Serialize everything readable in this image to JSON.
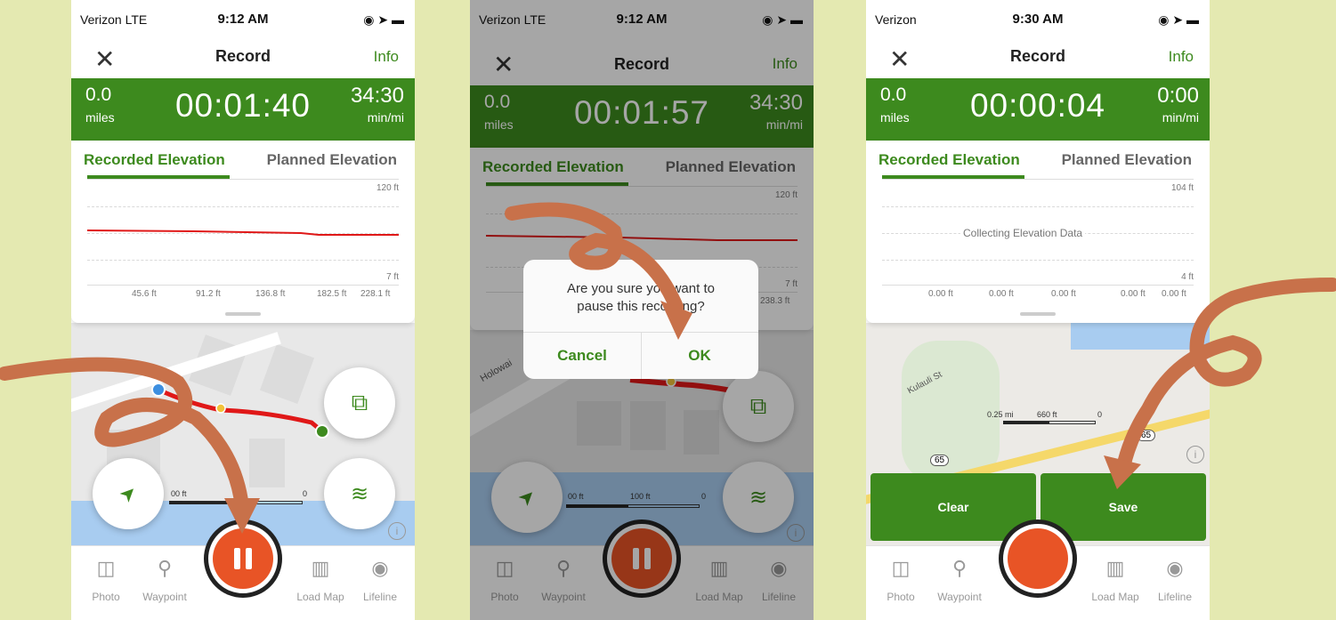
{
  "colors": {
    "brand_green": "#3d8a1e",
    "record_orange": "#e85426",
    "background": "#e4e9b1",
    "arrow": "#c8714a"
  },
  "screens": [
    {
      "status": {
        "carrier": "Verizon  LTE",
        "time": "9:12 AM"
      },
      "nav": {
        "close": "✕",
        "title": "Record",
        "info": "Info"
      },
      "stats": {
        "distance": "0.0",
        "distance_unit": "miles",
        "timer": "00:01:40",
        "pace": "34:30",
        "pace_unit": "min/mi"
      },
      "tabs": {
        "recorded": "Recorded Elevation",
        "planned": "Planned Elevation"
      },
      "axis": {
        "ymax": "120 ft",
        "ymin": "7 ft",
        "x": [
          "45.6 ft",
          "91.2 ft",
          "136.8 ft",
          "182.5 ft",
          "228.1 ft"
        ]
      },
      "scale": {
        "left": "00 ft",
        "mid": "ft",
        "right": "0"
      },
      "tabbar": {
        "photo": "Photo",
        "waypoint": "Waypoint",
        "loadmap": "Load Map",
        "lifeline": "Lifeline"
      }
    },
    {
      "status": {
        "carrier": "Verizon  LTE",
        "time": "9:12 AM"
      },
      "nav": {
        "close": "✕",
        "title": "Record",
        "info": "Info"
      },
      "stats": {
        "distance": "0.0",
        "distance_unit": "miles",
        "timer": "00:01:57",
        "pace": "34:30",
        "pace_unit": "min/mi"
      },
      "tabs": {
        "recorded": "Recorded Elevation",
        "planned": "Planned Elevation"
      },
      "axis": {
        "ymax": "120 ft",
        "ymin": "7 ft",
        "x_last": "238.3 ft"
      },
      "map_label": "Holowai",
      "scale": {
        "left": "00 ft",
        "mid": "100 ft",
        "right": "0"
      },
      "dialog": {
        "message_line1": "Are you sure you want to",
        "message_line2": "pause this recording?",
        "cancel": "Cancel",
        "ok": "OK"
      },
      "tabbar": {
        "photo": "Photo",
        "waypoint": "Waypoint",
        "loadmap": "Load Map",
        "lifeline": "Lifeline"
      }
    },
    {
      "status": {
        "carrier": "Verizon",
        "time": "9:30 AM"
      },
      "nav": {
        "close": "✕",
        "title": "Record",
        "info": "Info"
      },
      "stats": {
        "distance": "0.0",
        "distance_unit": "miles",
        "timer": "00:00:04",
        "pace": "0:00",
        "pace_unit": "min/mi"
      },
      "tabs": {
        "recorded": "Recorded Elevation",
        "planned": "Planned Elevation"
      },
      "axis": {
        "ymax": "104 ft",
        "ymin": "4 ft",
        "x": [
          "0.00 ft",
          "0.00 ft",
          "0.00 ft",
          "0.00 ft",
          "0.00 ft"
        ]
      },
      "collecting": "Collecting Elevation Data",
      "map_label": "Kulauli St",
      "scale": {
        "left": "0.25 mi",
        "mid": "660 ft",
        "right": "0"
      },
      "route_badges": [
        "65",
        "65"
      ],
      "actions": {
        "clear": "Clear",
        "save": "Save"
      },
      "tabbar": {
        "photo": "Photo",
        "waypoint": "Waypoint",
        "loadmap": "Load Map",
        "lifeline": "Lifeline"
      }
    }
  ]
}
